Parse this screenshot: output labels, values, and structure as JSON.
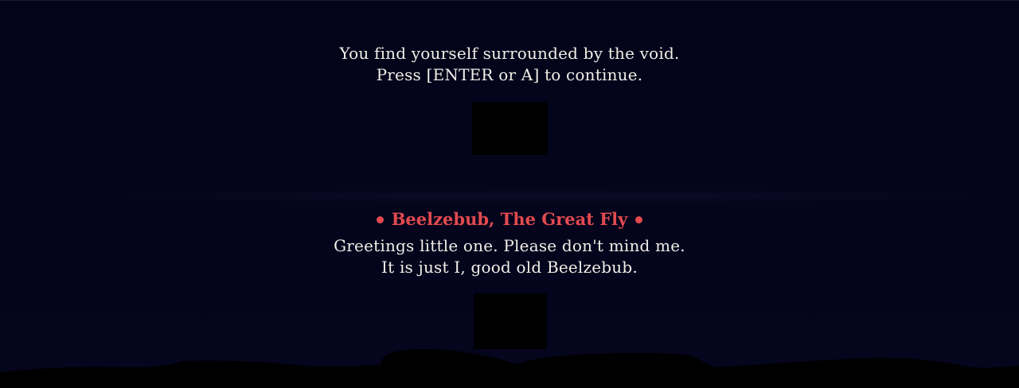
{
  "narration": {
    "line1": "You find yourself surrounded by the void.",
    "line2": "Press [ENTER or A] to continue."
  },
  "dialogue": {
    "speaker_name": "Beelzebub, The Great Fly",
    "line1": "Greetings little one. Please don't mind me.",
    "line2": "It is just I, good old Beelzebub."
  },
  "colors": {
    "background": "#04031a",
    "text": "#f2efe8",
    "speaker": "#e24a4f",
    "silhouette": "#000000"
  },
  "icons": {
    "speaker_bullet": "dot-icon",
    "portrait": "blank-portrait-icon"
  }
}
